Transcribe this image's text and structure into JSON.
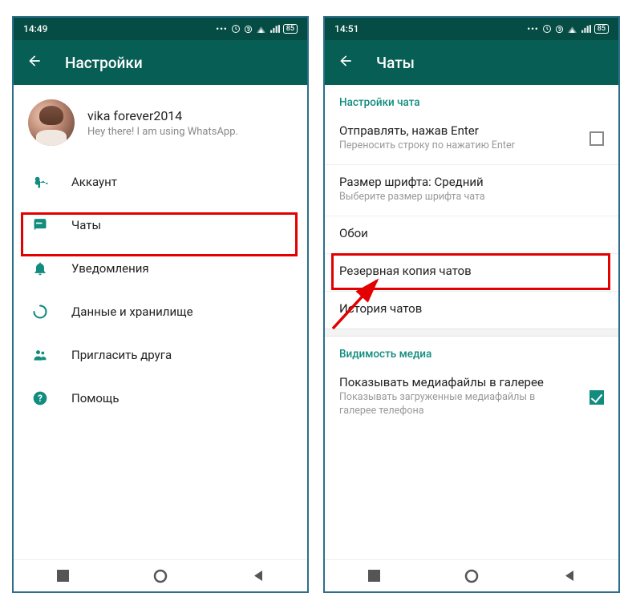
{
  "left": {
    "status": {
      "time": "14:49",
      "icons": "... ⏰ ® 📶 📶 🔋85"
    },
    "appbar_title": "Настройки",
    "profile": {
      "name": "vika forever2014",
      "status": "Hey there! I am using WhatsApp."
    },
    "items": [
      {
        "icon": "key",
        "label": "Аккаунт"
      },
      {
        "icon": "chat",
        "label": "Чаты"
      },
      {
        "icon": "bell",
        "label": "Уведомления"
      },
      {
        "icon": "data",
        "label": "Данные и хранилище"
      },
      {
        "icon": "invite",
        "label": "Пригласить друга"
      },
      {
        "icon": "help",
        "label": "Помощь"
      }
    ]
  },
  "right": {
    "status": {
      "time": "14:51",
      "icons": "... ⏰ ® 📶 📶 🔋85"
    },
    "appbar_title": "Чаты",
    "section1_header": "Настройки чата",
    "enter": {
      "title": "Отправлять, нажав Enter",
      "sub": "Переносить строку по нажатию Enter"
    },
    "font": {
      "title": "Размер шрифта: Средний",
      "sub": "Выберите размер шрифта чата"
    },
    "wallpaper": {
      "title": "Обои"
    },
    "backup": {
      "title": "Резервная копия чатов"
    },
    "history": {
      "title": "История чатов"
    },
    "section2_header": "Видимость медиа",
    "media": {
      "title": "Показывать медиафайлы в галерее",
      "sub": "Показывать загруженные медиафайлы в галерее телефона"
    }
  }
}
